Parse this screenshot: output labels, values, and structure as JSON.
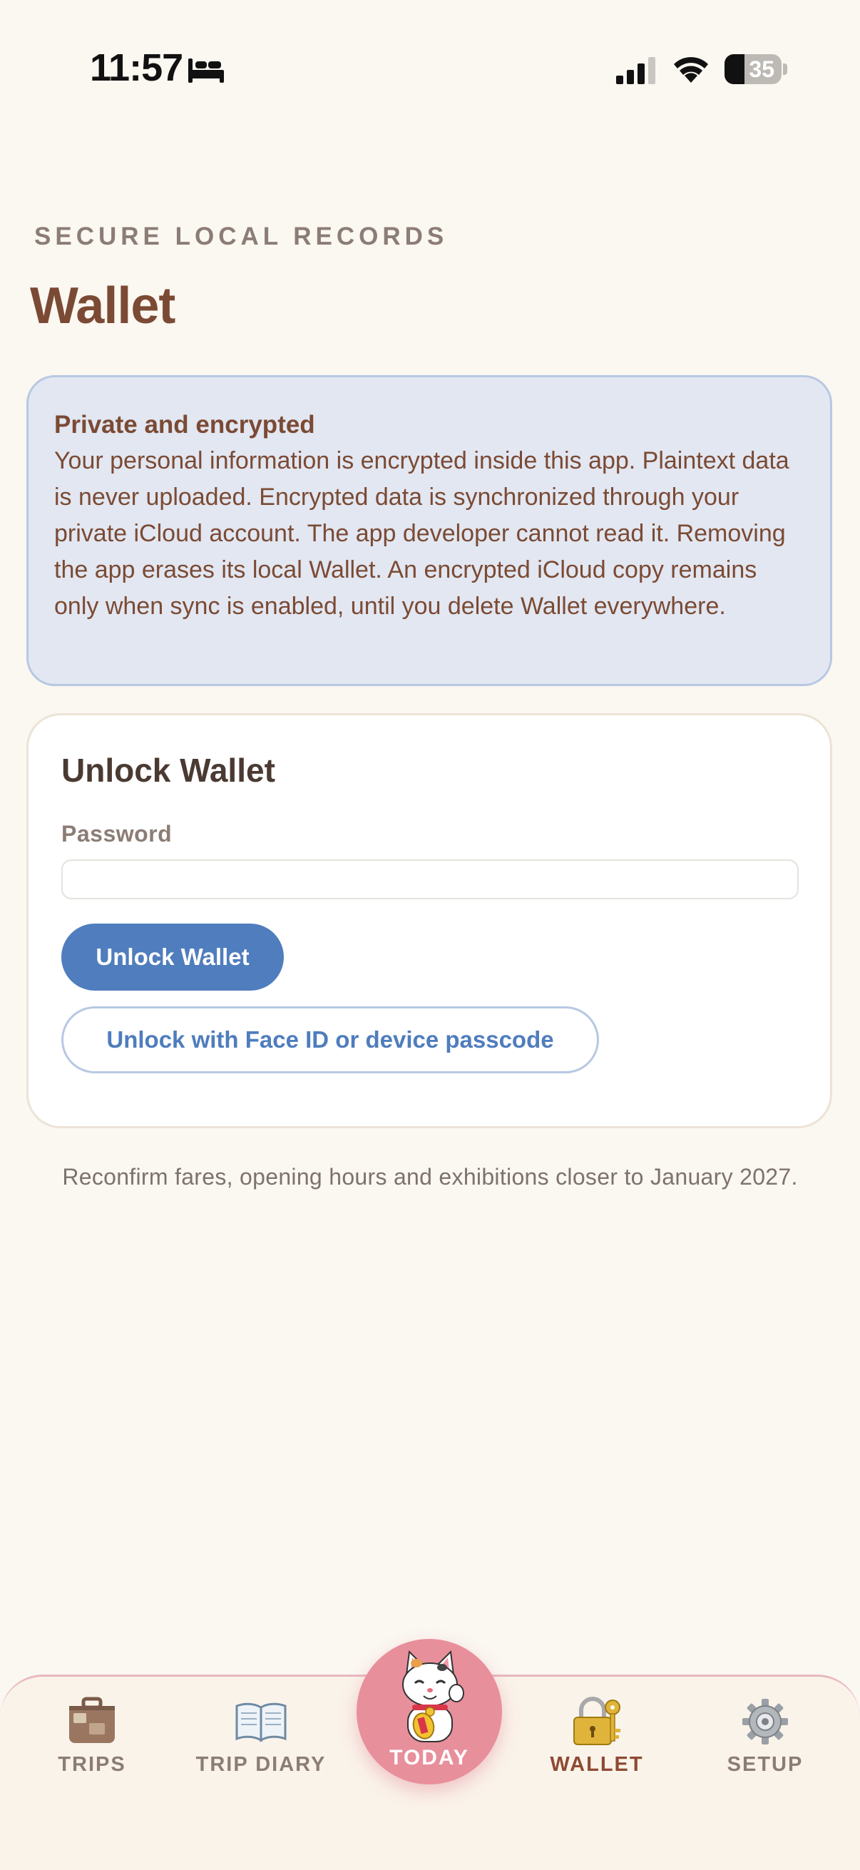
{
  "status_bar": {
    "time": "11:57",
    "focus_icon": "bed-icon",
    "battery_level": "35",
    "battery_percent": 35
  },
  "header": {
    "eyebrow": "SECURE LOCAL RECORDS",
    "title": "Wallet"
  },
  "info_card": {
    "title": "Private and encrypted",
    "body": "Your personal information is encrypted inside this app. Plaintext data is never uploaded. Encrypted data is synchronized through your private iCloud account. The app developer cannot read it. Removing the app erases its local Wallet. An encrypted iCloud copy remains only when sync is enabled, until you delete Wallet everywhere."
  },
  "unlock_card": {
    "title": "Unlock Wallet",
    "password_label": "Password",
    "password_value": "",
    "unlock_button": "Unlock Wallet",
    "face_id_button": "Unlock with Face ID or device passcode"
  },
  "footnote": "Reconfirm fares, opening hours and exhibitions closer to January 2027.",
  "tab_bar": {
    "trips": "TRIPS",
    "trip_diary": "TRIP DIARY",
    "today": "TODAY",
    "wallet": "WALLET",
    "setup": "SETUP",
    "active": "wallet"
  },
  "colors": {
    "background": "#fbf7f1",
    "accent_blue": "#4f7dbd",
    "brand_brown": "#7b4a34",
    "today_pink": "#e88f9c"
  }
}
